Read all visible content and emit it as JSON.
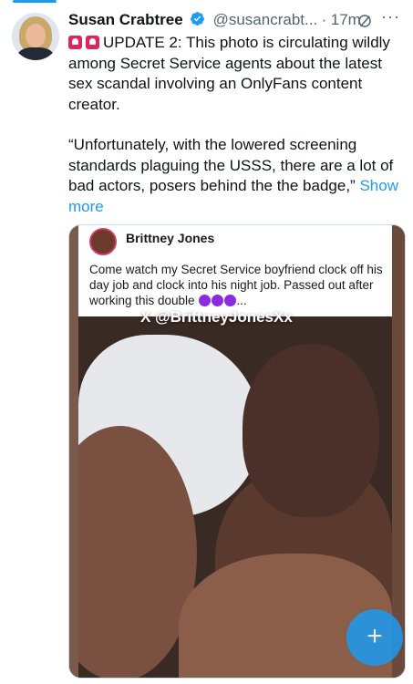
{
  "tweet": {
    "author_name": "Susan Crabtree",
    "author_handle": "@susancrabt...",
    "separator": "·",
    "time": "17m",
    "more_label": "···",
    "paragraph1": "UPDATE 2: This photo is circulating wildly among Secret Service agents about the latest sex scandal involving an OnlyFans content creator.",
    "paragraph2": "“Unfortunately, with the lowered screening standards plaguing the USSS, there are a lot of bad actors, posers behind the the badge,”",
    "show_more": "Show more",
    "emoji_icons": [
      "siren-icon",
      "siren-icon"
    ]
  },
  "media": {
    "story_author": "Brittney Jones",
    "story_caption": "Come watch my Secret Service boyfriend clock off his day job and clock into his night job. Passed out after working this double",
    "caption_ellipsis": "...",
    "watermark": "X @BrittneyJonesXx"
  },
  "fab": {
    "label": "+"
  },
  "colors": {
    "accent": "#1d9bf0",
    "text": "#0f1419",
    "muted": "#536471"
  }
}
